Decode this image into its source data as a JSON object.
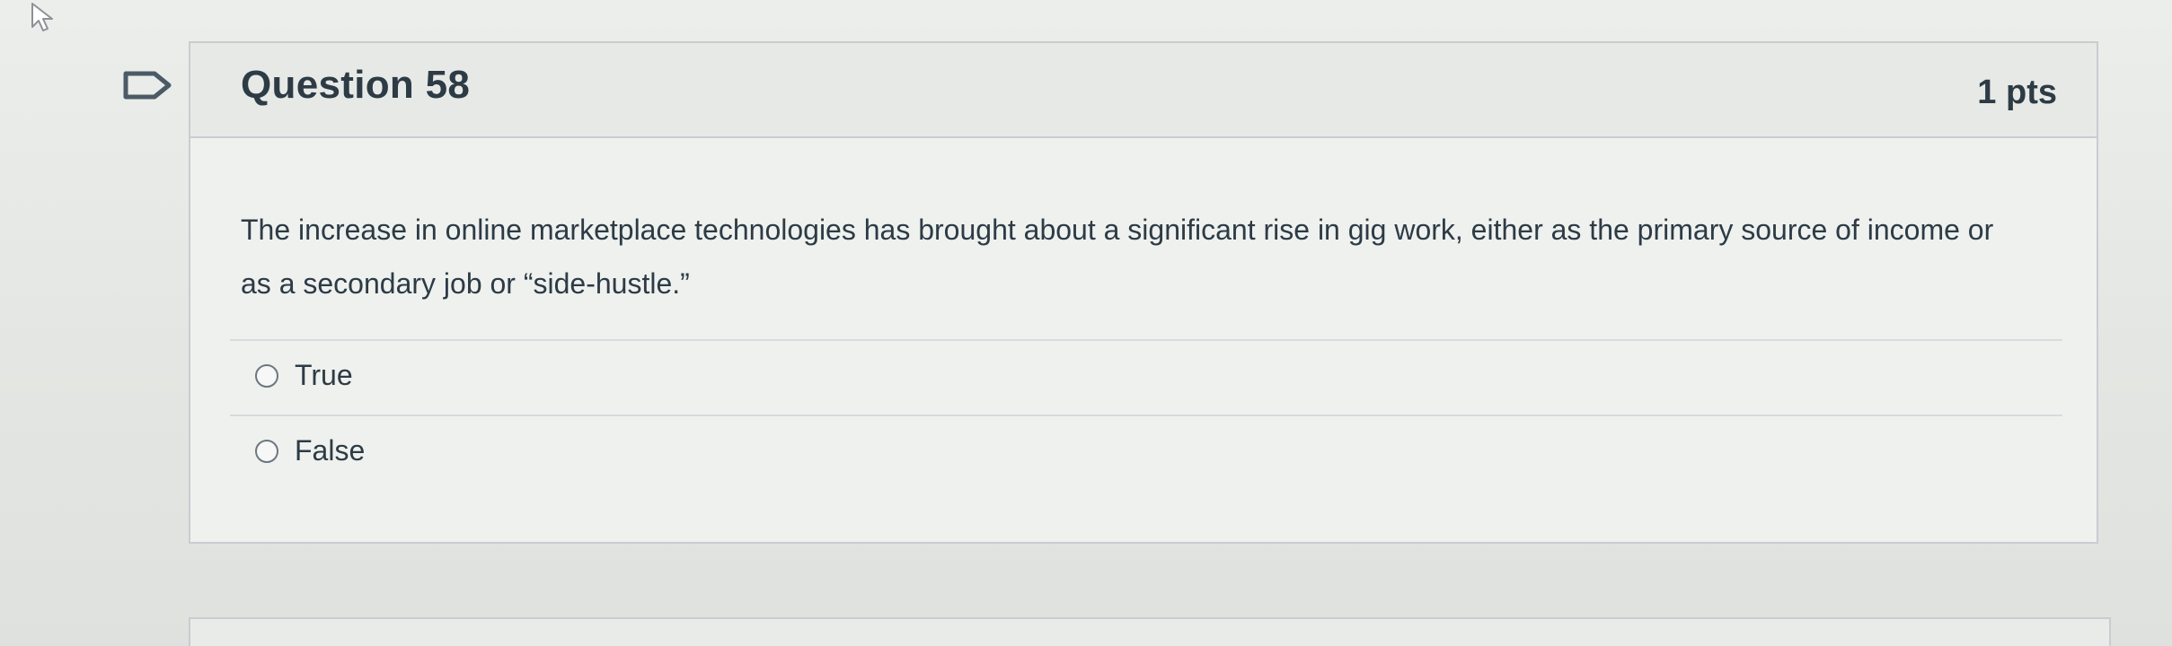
{
  "question": {
    "title": "Question 58",
    "points": "1 pts",
    "text": "The increase in online marketplace technologies has brought about a significant rise in gig work, either as the primary source of income or as a secondary job or “side-hustle.”",
    "answers": [
      {
        "label": "True",
        "selected": false
      },
      {
        "label": "False",
        "selected": false
      }
    ]
  },
  "icons": {
    "cursor": "mouse-pointer-icon",
    "flag": "flag-question-icon"
  }
}
